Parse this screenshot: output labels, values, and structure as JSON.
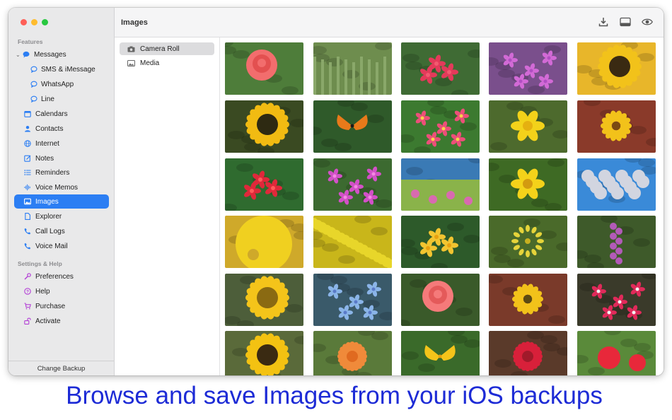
{
  "window": {
    "title": "Images"
  },
  "sidebar": {
    "sections": [
      {
        "header": "Features"
      },
      {
        "header": "Settings & Help"
      }
    ],
    "items": [
      {
        "label": "Messages",
        "icon": "message-bubble-icon",
        "color": "#2c7ef3"
      },
      {
        "label": "SMS & iMessage",
        "icon": "message-outline-icon",
        "color": "#2c7ef3"
      },
      {
        "label": "WhatsApp",
        "icon": "message-outline-icon",
        "color": "#2c7ef3"
      },
      {
        "label": "Line",
        "icon": "message-outline-icon",
        "color": "#2c7ef3"
      },
      {
        "label": "Calendars",
        "icon": "calendar-icon",
        "color": "#2c7ef3"
      },
      {
        "label": "Contacts",
        "icon": "person-icon",
        "color": "#2c7ef3"
      },
      {
        "label": "Internet",
        "icon": "globe-icon",
        "color": "#2c7ef3"
      },
      {
        "label": "Notes",
        "icon": "note-edit-icon",
        "color": "#2c7ef3"
      },
      {
        "label": "Reminders",
        "icon": "list-icon",
        "color": "#2c7ef3"
      },
      {
        "label": "Voice Memos",
        "icon": "waveform-icon",
        "color": "#2c7ef3"
      },
      {
        "label": "Images",
        "icon": "photo-icon",
        "color": "#2c7ef3"
      },
      {
        "label": "Explorer",
        "icon": "document-icon",
        "color": "#2c7ef3"
      },
      {
        "label": "Call Logs",
        "icon": "phone-icon",
        "color": "#2c7ef3"
      },
      {
        "label": "Voice Mail",
        "icon": "phone-voicemail-icon",
        "color": "#2c7ef3"
      },
      {
        "label": "Preferences",
        "icon": "wrench-icon",
        "color": "#b340d6"
      },
      {
        "label": "Help",
        "icon": "question-circle-icon",
        "color": "#b340d6"
      },
      {
        "label": "Purchase",
        "icon": "cart-icon",
        "color": "#b340d6"
      },
      {
        "label": "Activate",
        "icon": "lock-open-icon",
        "color": "#b340d6"
      }
    ],
    "selected": "Images",
    "footer_button": "Change Backup"
  },
  "toolbar": {
    "icons": [
      "download-icon",
      "preview-pane-icon",
      "eye-icon"
    ]
  },
  "source_list": [
    {
      "label": "Camera Roll",
      "icon": "camera-icon",
      "selected": true
    },
    {
      "label": "Media",
      "icon": "photo-icon",
      "selected": false
    }
  ],
  "thumbnails": [
    {
      "bg": "#4e7d3a",
      "flower": "#f26d6d",
      "center": "#e35050",
      "kind": "rose"
    },
    {
      "bg": "#6e8d4e",
      "flower": "#8aa86a",
      "center": "#cfd9b0",
      "kind": "garden"
    },
    {
      "bg": "#3f6b34",
      "flower": "#e43a5a",
      "center": "#f25a70",
      "kind": "small"
    },
    {
      "bg": "#7a4f8c",
      "flower": "#d26ad6",
      "center": "#b14ec2",
      "kind": "cluster"
    },
    {
      "bg": "#e8b62a",
      "flower": "#f2c21a",
      "center": "#3a2a12",
      "kind": "sunflower"
    },
    {
      "bg": "#3a4a22",
      "flower": "#f1bb12",
      "center": "#2e2a12",
      "kind": "sunflower"
    },
    {
      "bg": "#2f5a2a",
      "flower": "#e87a1a",
      "center": "#1a1a1a",
      "kind": "butterfly"
    },
    {
      "bg": "#3c7a30",
      "flower": "#ec4f79",
      "center": "#f7d24a",
      "kind": "cluster"
    },
    {
      "bg": "#4d6a2d",
      "flower": "#f3d21a",
      "center": "#e5b010",
      "kind": "daffodil"
    },
    {
      "bg": "#8a3a2a",
      "flower": "#f2c21a",
      "center": "#7a4a12",
      "kind": "daisy"
    },
    {
      "bg": "#2f6b2f",
      "flower": "#e0283a",
      "center": "#ff5a5a",
      "kind": "small"
    },
    {
      "bg": "#3c6a30",
      "flower": "#d350c8",
      "center": "#f28ae0",
      "kind": "cluster"
    },
    {
      "bg": "#3a7ab5",
      "flower": "#d86ab0",
      "center": "#8ab34a",
      "kind": "sea"
    },
    {
      "bg": "#3e6a24",
      "flower": "#f4d21a",
      "center": "#d39a10",
      "kind": "daffodil"
    },
    {
      "bg": "#3a8ad8",
      "flower": "#d2d5e0",
      "center": "#6a6a6a",
      "kind": "tree"
    },
    {
      "bg": "#cfa92a",
      "flower": "#f0d020",
      "center": "#6a8a20",
      "kind": "bush"
    },
    {
      "bg": "#c9b61a",
      "flower": "#e8d62a",
      "center": "#d8c418",
      "kind": "field"
    },
    {
      "bg": "#2d5a2a",
      "flower": "#f2c430",
      "center": "#e8a010",
      "kind": "small"
    },
    {
      "bg": "#4a6a2a",
      "flower": "#e6d43a",
      "center": "#c8b020",
      "kind": "star"
    },
    {
      "bg": "#3e5a2a",
      "flower": "#b35ab8",
      "center": "#8a3a98",
      "kind": "spike"
    },
    {
      "bg": "#4d5e3a",
      "flower": "#f4c41a",
      "center": "#8a6a12",
      "kind": "sunflower"
    },
    {
      "bg": "#3a5a6a",
      "flower": "#8ab4e8",
      "center": "#5a7ac8",
      "kind": "cluster"
    },
    {
      "bg": "#3a5a2a",
      "flower": "#f57a7a",
      "center": "#e45a5a",
      "kind": "rose"
    },
    {
      "bg": "#7a3a2a",
      "flower": "#f2c21a",
      "center": "#5a4a12",
      "kind": "daisy"
    },
    {
      "bg": "#3a3a2a",
      "flower": "#e02a5a",
      "center": "#f2f2f2",
      "kind": "cluster"
    },
    {
      "bg": "#5a6a3a",
      "flower": "#f3c212",
      "center": "#3a2a12",
      "kind": "sunflower"
    },
    {
      "bg": "#5a7a3a",
      "flower": "#f08a3a",
      "center": "#e06a20",
      "kind": "dahlia"
    },
    {
      "bg": "#3a6a2a",
      "flower": "#f4c41a",
      "center": "#e8a010",
      "kind": "butterfly"
    },
    {
      "bg": "#5a3a2a",
      "flower": "#d8203a",
      "center": "#a01a2a",
      "kind": "dahlia"
    },
    {
      "bg": "#5a8a3a",
      "flower": "#e8283a",
      "center": "#2a1a1a",
      "kind": "tulip"
    }
  ],
  "caption": "Browse and save Images from your iOS backups"
}
